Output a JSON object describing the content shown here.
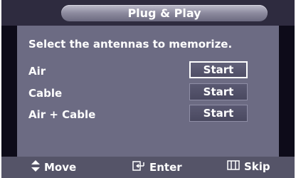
{
  "window": {
    "title": "Plug & Play"
  },
  "main": {
    "prompt": "Select the antennas to memorize.",
    "options": [
      {
        "label": "Air",
        "button": "Start",
        "selected": true
      },
      {
        "label": "Cable",
        "button": "Start",
        "selected": false
      },
      {
        "label": "Air + Cable",
        "button": "Start",
        "selected": false
      }
    ]
  },
  "footer": {
    "move": {
      "icon": "up-down-arrows-icon",
      "label": "Move"
    },
    "enter": {
      "icon": "enter-icon",
      "label": "Enter"
    },
    "skip": {
      "icon": "menu-bars-icon",
      "label": "Skip"
    }
  },
  "colors": {
    "background": "#0d0b19",
    "title_bar": "#2e2b3f",
    "panel": "#6c6b83",
    "footer": "#555468",
    "selected_border": "#ffffff"
  }
}
